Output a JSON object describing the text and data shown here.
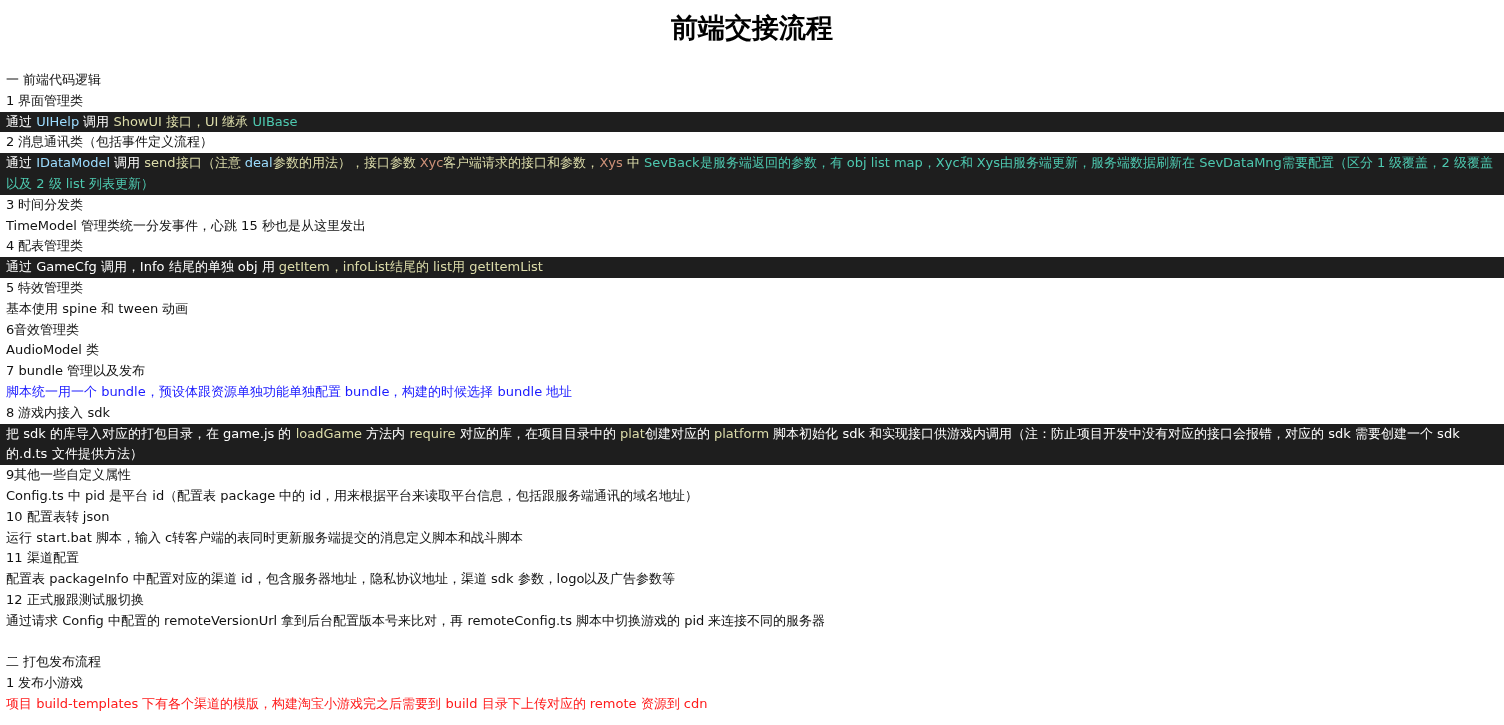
{
  "title": "前端交接流程",
  "blocks": [
    {
      "kind": "text",
      "text": "一  前端代码逻辑"
    },
    {
      "kind": "text",
      "text": "1  界面管理类"
    },
    {
      "kind": "code",
      "segments": [
        {
          "text": "通过 ",
          "kind": "plain"
        },
        {
          "text": "UIHelp",
          "kind": "variable"
        },
        {
          "text": " 调用 ",
          "kind": "plain"
        },
        {
          "text": "ShowUI",
          "kind": "function"
        },
        {
          "text": " 接口，UI 继承 ",
          "kind": "function"
        },
        {
          "text": "UIBase",
          "kind": "type"
        }
      ]
    },
    {
      "kind": "text",
      "text": "2  消息通讯类（包括事件定义流程）"
    },
    {
      "kind": "code",
      "segments": [
        {
          "text": "通过 ",
          "kind": "plain"
        },
        {
          "text": "IDataModel",
          "kind": "variable"
        },
        {
          "text": " 调用 ",
          "kind": "plain"
        },
        {
          "text": "send",
          "kind": "function"
        },
        {
          "text": "接口（注意 ",
          "kind": "function"
        },
        {
          "text": "deal",
          "kind": "variable"
        },
        {
          "text": "参数的用法），接口参数 ",
          "kind": "function"
        },
        {
          "text": "Xyc",
          "kind": "string"
        },
        {
          "text": "客户端请求的接口和参数，",
          "kind": "function"
        },
        {
          "text": "Xys",
          "kind": "string"
        },
        {
          "text": " 中 ",
          "kind": "function"
        },
        {
          "text": "SevBack",
          "kind": "type"
        },
        {
          "text": "是服务端返回的参数，有 obj list map，Xyc和 Xys由服务端更新，服务端数据刷新在 SevDataMng需要配置（区分 1 级覆盖，2 级覆盖以及 2 级 list 列表更新）",
          "kind": "type"
        }
      ]
    },
    {
      "kind": "text",
      "text": "3  时间分发类"
    },
    {
      "kind": "text",
      "text": "TimeModel 管理类统一分发事件，心跳 15 秒也是从这里发出"
    },
    {
      "kind": "text",
      "text": "4  配表管理类"
    },
    {
      "kind": "code",
      "segments": [
        {
          "text": "通过 GameCfg 调用，Info 结尾的单独 obj 用 ",
          "kind": "plain"
        },
        {
          "text": "getItem，infoList结尾的 list用 getItemList",
          "kind": "function"
        }
      ]
    },
    {
      "kind": "text",
      "text": "5  特效管理类"
    },
    {
      "kind": "text",
      "text": "基本使用 spine 和 tween 动画"
    },
    {
      "kind": "text",
      "text": "6音效管理类"
    },
    {
      "kind": "text",
      "text": "AudioModel 类"
    },
    {
      "kind": "text",
      "text": "7 bundle 管理以及发布"
    },
    {
      "kind": "blue",
      "text": "脚本统一用一个 bundle，预设体跟资源单独功能单独配置 bundle，构建的时候选择 bundle 地址"
    },
    {
      "kind": "text",
      "text": "8  游戏内接入 sdk"
    },
    {
      "kind": "code",
      "segments": [
        {
          "text": "把 sdk 的库导入对应的打包目录，在 game.js 的 ",
          "kind": "plain"
        },
        {
          "text": "loadGame",
          "kind": "function"
        },
        {
          "text": " 方法内 ",
          "kind": "plain"
        },
        {
          "text": "require",
          "kind": "function"
        },
        {
          "text": " 对应的库，在项目目录中的 ",
          "kind": "plain"
        },
        {
          "text": "plat",
          "kind": "function"
        },
        {
          "text": "创建对应的 ",
          "kind": "plain"
        },
        {
          "text": "platform",
          "kind": "function"
        },
        {
          "text": " 脚本初始化 sdk 和实现接口供游戏内调用（注：防止项目开发中没有对应的接口会报错，对应的 sdk 需要创建一个 sdk 的.d.ts 文件提供方法）",
          "kind": "plain"
        }
      ]
    },
    {
      "kind": "text",
      "text": "9其他一些自定义属性"
    },
    {
      "kind": "text",
      "text": "Config.ts 中 pid 是平台 id（配置表 package 中的 id，用来根据平台来读取平台信息，包括跟服务端通讯的域名地址）"
    },
    {
      "kind": "text",
      "text": "10  配置表转 json"
    },
    {
      "kind": "text",
      "text": "运行 start.bat 脚本，输入 c转客户端的表同时更新服务端提交的消息定义脚本和战斗脚本"
    },
    {
      "kind": "text",
      "text": "11  渠道配置"
    },
    {
      "kind": "text",
      "text": "配置表 packageInfo 中配置对应的渠道 id，包含服务器地址，隐私协议地址，渠道 sdk 参数，logo以及广告参数等"
    },
    {
      "kind": "text",
      "text": "12  正式服跟测试服切换"
    },
    {
      "kind": "text",
      "text": "通过请求 Config 中配置的 remoteVersionUrl 拿到后台配置版本号来比对，再 remoteConfig.ts 脚本中切换游戏的 pid 来连接不同的服务器"
    },
    {
      "kind": "blank"
    },
    {
      "kind": "text",
      "text": "二  打包发布流程"
    },
    {
      "kind": "text",
      "text": "1  发布小游戏"
    },
    {
      "kind": "red",
      "text": "项目 build-templates 下有各个渠道的模版，构建淘宝小游戏完之后需要到 build 目录下上传对应的 remote 资源到 cdn"
    }
  ]
}
